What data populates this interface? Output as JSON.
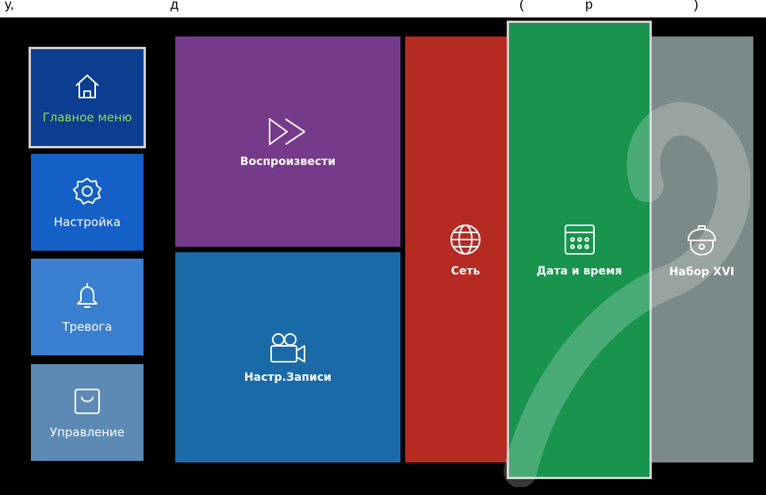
{
  "header": {
    "fragment_left": "у, ",
    "fragment_mid": "д",
    "fragment_right": "(",
    "fragment_end": "р",
    "fragment_close": ")"
  },
  "sidebar": {
    "items": [
      {
        "label": "Главное меню",
        "icon": "home-icon",
        "color": "#0b3d91",
        "selected": true,
        "label_color": "#8ee04a"
      },
      {
        "label": "Настройка",
        "icon": "gear-icon",
        "color": "#1560c7"
      },
      {
        "label": "Тревога",
        "icon": "bell-icon",
        "color": "#3a7fd0"
      },
      {
        "label": "Управление",
        "icon": "bag-icon",
        "color": "#5d8ab5"
      }
    ]
  },
  "main": {
    "tiles": [
      {
        "label": "Воспроизвести",
        "icon": "fast-forward-icon",
        "color": "#763a8a"
      },
      {
        "label": "Настр.Записи",
        "icon": "video-camera-icon",
        "color": "#1b6aa8"
      },
      {
        "label": "Сеть",
        "icon": "globe-icon",
        "color": "#b52a21"
      },
      {
        "label": "Дата и время",
        "icon": "calendar-icon",
        "color": "#18944f",
        "selected": true
      },
      {
        "label": "Набор XVI",
        "icon": "dome-camera-icon",
        "color": "#7b8a88"
      }
    ]
  }
}
